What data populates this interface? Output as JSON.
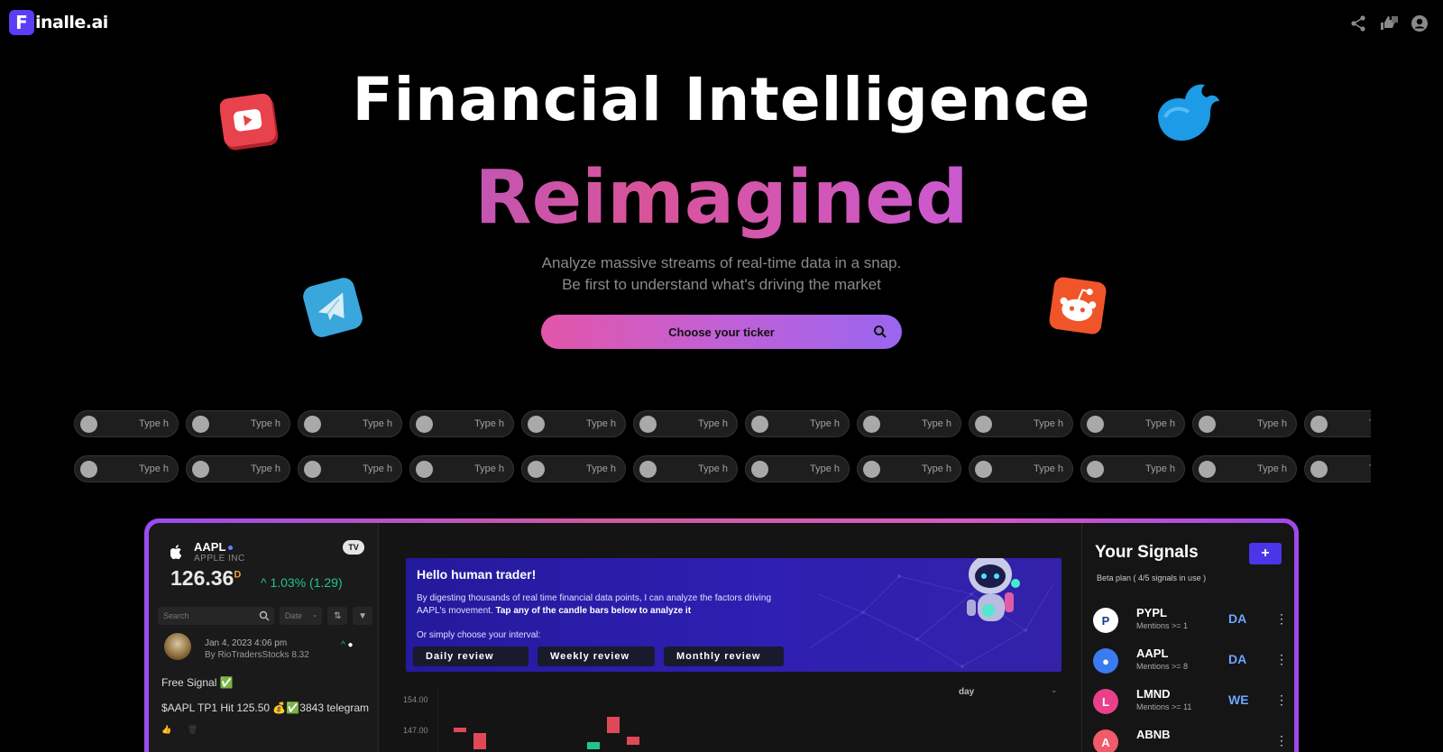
{
  "header": {
    "logo_letter": "F",
    "logo_text": "inalle.ai",
    "icons": [
      "share-icon",
      "feedback-icon",
      "account-icon"
    ]
  },
  "hero": {
    "title": "Financial  Intelligence",
    "subtitle": "Reimagined",
    "desc_line1": "Analyze massive streams of real-time data in a snap.",
    "desc_line2": "Be first to understand what's driving the market",
    "ticker_button": "Choose your ticker"
  },
  "chips": {
    "placeholder": "Type h",
    "row_count": 2,
    "chips_per_row": 12
  },
  "colors": {
    "brand": "#5b3df5",
    "gradient_start": "#e256a8",
    "gradient_end": "#9a66ef",
    "positive": "#23c48a",
    "negative": "#e0485a",
    "accent_blue": "#6ea6ff"
  },
  "dashboard": {
    "left": {
      "ticker": "AAPL",
      "company": "APPLE INC",
      "tv_badge": "TV",
      "price": "126.36",
      "price_suffix": "D",
      "change": "^ 1.03% (1.29)",
      "search_placeholder": "Search",
      "date_select": "Date",
      "post": {
        "date": "Jan 4, 2023 4:06 pm",
        "author": "By RioTradersStocks  8.32",
        "line1": "Free Signal ✅",
        "line2": "$AAPL TP1 Hit 125.50 💰✅3843  telegram"
      }
    },
    "welcome": {
      "title": "Hello human trader!",
      "body_plain": "By digesting thousands of real time financial data points, I can analyze the factors driving AAPL's movement. ",
      "body_bold": "Tap any of the candle bars below to analyze it",
      "or_text": "Or simply choose your interval:",
      "buttons": [
        "Daily review",
        "Weekly review",
        "Monthly review"
      ]
    },
    "chart": {
      "interval": "day",
      "y_ticks": [
        "154.00",
        "147.00"
      ]
    },
    "signals": {
      "title": "Your Signals",
      "add_label": "+",
      "plan": "Beta plan ( 4/5 signals in use )",
      "items": [
        {
          "symbol": "PYPL",
          "mentions": "Mentions >=  1",
          "period": "DA"
        },
        {
          "symbol": "AAPL",
          "mentions": "Mentions >=  8",
          "period": "DA"
        },
        {
          "symbol": "LMND",
          "mentions": "Mentions >=  11",
          "period": "WE"
        },
        {
          "symbol": "ABNB",
          "mentions": "",
          "period": ""
        }
      ]
    }
  }
}
